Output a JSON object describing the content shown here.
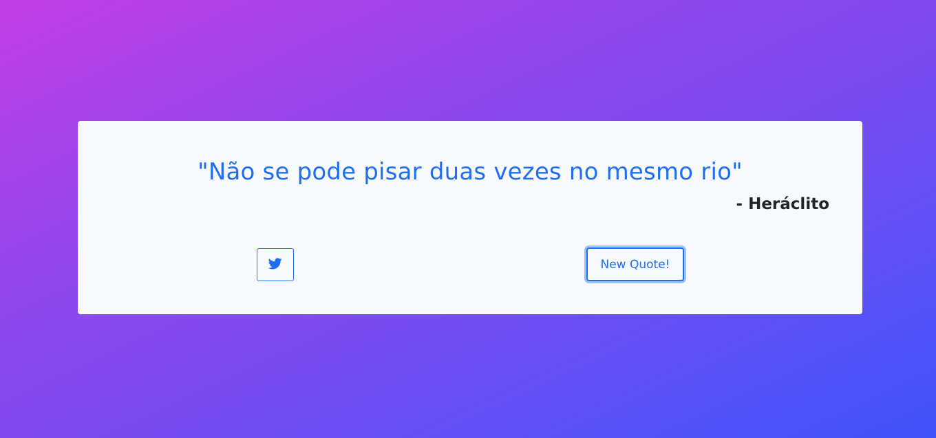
{
  "quote": {
    "text": "\"Não se pode pisar duas vezes no mesmo rio\"",
    "author": "- Heráclito"
  },
  "actions": {
    "tweet_icon": "twitter-icon",
    "new_quote_label": "New Quote!"
  },
  "colors": {
    "accent": "#1f6ff0",
    "card_background": "#f8f9fa",
    "author_text": "#212529",
    "gradient_start": "#c23fe6",
    "gradient_end": "#3f52fb"
  }
}
